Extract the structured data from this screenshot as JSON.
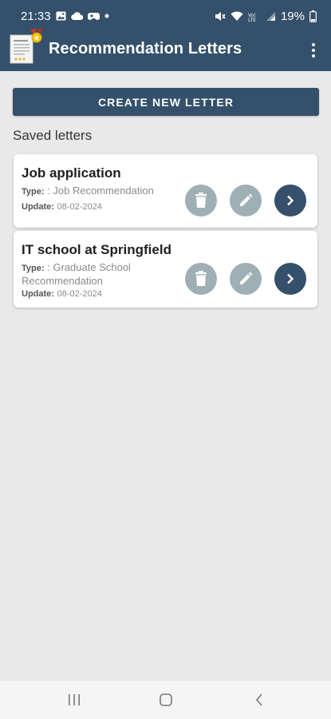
{
  "status_bar": {
    "time": "21:33",
    "battery": "19%",
    "icons": [
      "gallery-icon",
      "cloud-icon",
      "gamepad-icon",
      "dot-icon",
      "mute-icon",
      "wifi-icon",
      "volte-icon",
      "signal-icon",
      "battery-icon"
    ]
  },
  "app_bar": {
    "title": "Recommendation Letters",
    "logo_icon": "certificate-icon",
    "menu_icon": "more-vert-icon"
  },
  "create_button": {
    "label": "CREATE NEW LETTER"
  },
  "saved_section": {
    "heading": "Saved letters",
    "letters": [
      {
        "title": "Job application",
        "type_label": "Type:",
        "type_value": ": Job Recommendation",
        "update_label": "Update:",
        "update_value": "08-02-2024"
      },
      {
        "title": "IT school at Springfield",
        "type_label": "Type:",
        "type_value": ": Graduate School Recommendation",
        "update_label": "Update:",
        "update_value": "08-02-2024"
      }
    ]
  },
  "nav_bar": {
    "icons": [
      "recents-icon",
      "home-icon",
      "back-icon"
    ]
  },
  "colors": {
    "primary": "#34506a",
    "secondary_button": "#9fb0b5",
    "background": "#e9e9e9",
    "card": "#ffffff"
  }
}
